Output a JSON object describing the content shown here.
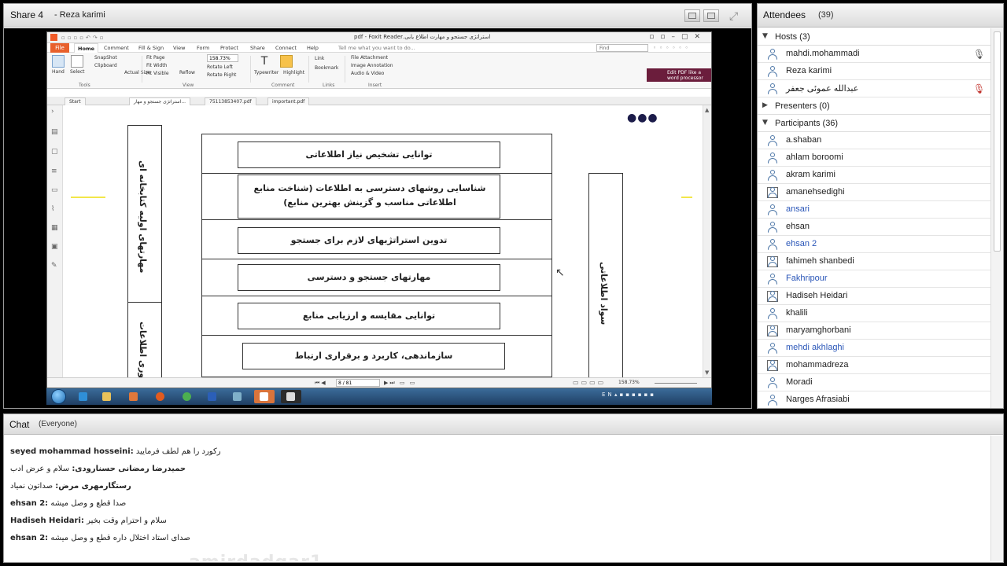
{
  "share": {
    "title": "Share 4",
    "presenter": "- Reza karimi"
  },
  "foxit": {
    "doc_title": "استراتژی جستجو و مهارت اطلاع یابی.pdf - Foxit Reader",
    "menu": {
      "file": "File",
      "items": [
        "Home",
        "Comment",
        "Fill & Sign",
        "View",
        "Form",
        "Protect",
        "Share",
        "Connect",
        "Help"
      ],
      "tell_me": "Tell me what you want to do...",
      "find_placeholder": "Find"
    },
    "ribbon": {
      "hand": "Hand",
      "select": "Select",
      "snapshot": "SnapShot",
      "clipboard": "Clipboard",
      "actual_size": "Actual Size",
      "fit_page": "Fit Page",
      "fit_width": "Fit Width",
      "fit_visible": "Fit Visible",
      "zoom": "158.73%",
      "reflow": "Reflow",
      "rotate_left": "Rotate Left",
      "rotate_right": "Rotate Right",
      "typewriter": "Typewriter",
      "highlight": "Highlight",
      "link": "Link",
      "bookmark": "Bookmark",
      "file_attachment": "File Attachment",
      "image_annotation": "Image Annotation",
      "audio_video": "Audio & Video",
      "groups": [
        "Tools",
        "View",
        "Comment",
        "Links",
        "Insert"
      ],
      "edit_pdf": "Edit PDF like a word processor"
    },
    "tabs": [
      "Start",
      "استراتژی جستجو و مهار...",
      "75113853407.pdf",
      "important.pdf"
    ],
    "diagram": {
      "left_top_label": "مهارتهای اولیه کتابخانه ای",
      "left_bottom_label": "فناوری اطلاعات",
      "right_label": "سواد اطلاعاتی",
      "steps": [
        "توانایی تشخیص نیاز اطلاعاتی",
        "شناسایی روشهای دسترسی به اطلاعات (شناخت منابع اطلاعاتی مناسب و گزینش بهترین منابع)",
        "تدوین استراتژیهای لازم برای جستجو",
        "مهارتهای جستجو و دسترسی",
        "توانایی مقایسه و ارزیابی منابع",
        "سازماندهی، کاربرد و برقراری ارتباط"
      ]
    },
    "status": {
      "page": "8 / 81",
      "zoom": "158.73%"
    },
    "taskbar": {
      "lang": "EN"
    }
  },
  "attendees": {
    "title": "Attendees",
    "count": "(39)",
    "hosts_label": "Hosts (3)",
    "hosts": [
      {
        "name": "mahdi.mohammadi",
        "status": "mic"
      },
      {
        "name": "Reza karimi",
        "status": ""
      },
      {
        "name": "عبدالله عموئی جعفر",
        "status": "mic-off"
      }
    ],
    "presenters_label": "Presenters (0)",
    "participants_label": "Participants (36)",
    "participants": [
      {
        "name": "a.shaban",
        "blue": false,
        "framed": false
      },
      {
        "name": "ahlam boroomi",
        "blue": false,
        "framed": false
      },
      {
        "name": "akram karimi",
        "blue": false,
        "framed": false
      },
      {
        "name": "amanehsedighi",
        "blue": false,
        "framed": true
      },
      {
        "name": "ansari",
        "blue": true,
        "framed": false
      },
      {
        "name": "ehsan",
        "blue": false,
        "framed": false
      },
      {
        "name": "ehsan 2",
        "blue": true,
        "framed": false
      },
      {
        "name": "fahimeh shanbedi",
        "blue": false,
        "framed": true
      },
      {
        "name": "Fakhripour",
        "blue": true,
        "framed": false
      },
      {
        "name": "Hadiseh Heidari",
        "blue": false,
        "framed": true
      },
      {
        "name": "khalili",
        "blue": false,
        "framed": false
      },
      {
        "name": "maryamghorbani",
        "blue": false,
        "framed": true
      },
      {
        "name": "mehdi akhlaghi",
        "blue": true,
        "framed": false
      },
      {
        "name": "mohammadreza",
        "blue": false,
        "framed": true
      },
      {
        "name": "Moradi",
        "blue": false,
        "framed": false
      },
      {
        "name": "Narges Afrasiabi",
        "blue": false,
        "framed": false
      }
    ]
  },
  "chat": {
    "title": "Chat",
    "scope": "(Everyone)",
    "messages": [
      {
        "sender": "seyed mohammad hosseini:",
        "text": "رکورد را هم لطف فرمایید"
      },
      {
        "sender": "حمیدرضا رمضانی حسنارودی:",
        "text": "سلام و عرض ادب"
      },
      {
        "sender": "رستگارمهری مرض:",
        "text": "صداتون نمیاد"
      },
      {
        "sender": "ehsan 2:",
        "text": "صدا قطع و وصل میشه"
      },
      {
        "sender": "Hadiseh Heidari:",
        "text": "سلام و احترام وقت بخیر"
      },
      {
        "sender": "ehsan 2:",
        "text": "صدای استاد اختلال داره قطع و وصل میشه"
      }
    ],
    "watermark": "amirdadgar1"
  },
  "colors": {
    "foxit_orange": "#e8602c",
    "banner": "#6b1d3c",
    "participant_blue": "#2a56b8"
  }
}
